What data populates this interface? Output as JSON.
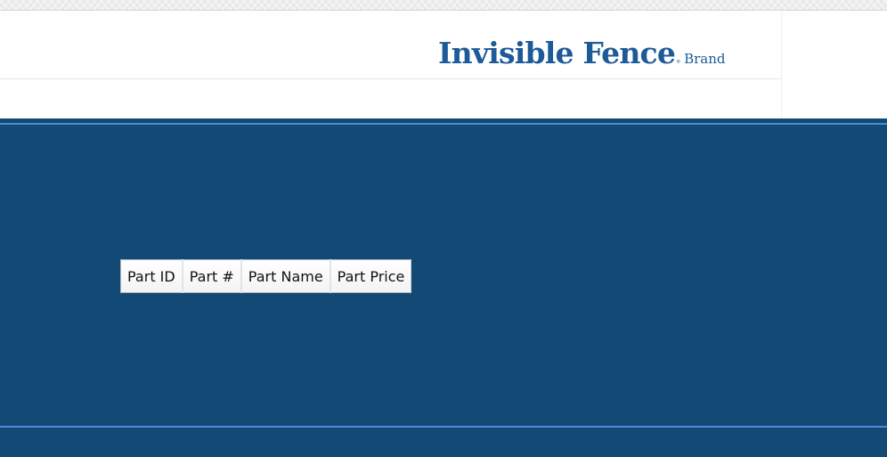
{
  "header": {
    "logo": {
      "main": "Invisible Fence",
      "registered": "®",
      "brand": "Brand"
    }
  },
  "parts_table": {
    "columns": [
      "Part ID",
      "Part #",
      "Part Name",
      "Part Price"
    ]
  },
  "colors": {
    "brand_blue": "#1d5a98",
    "page_background": "#124a75",
    "accent_line": "#4a8ed3"
  }
}
